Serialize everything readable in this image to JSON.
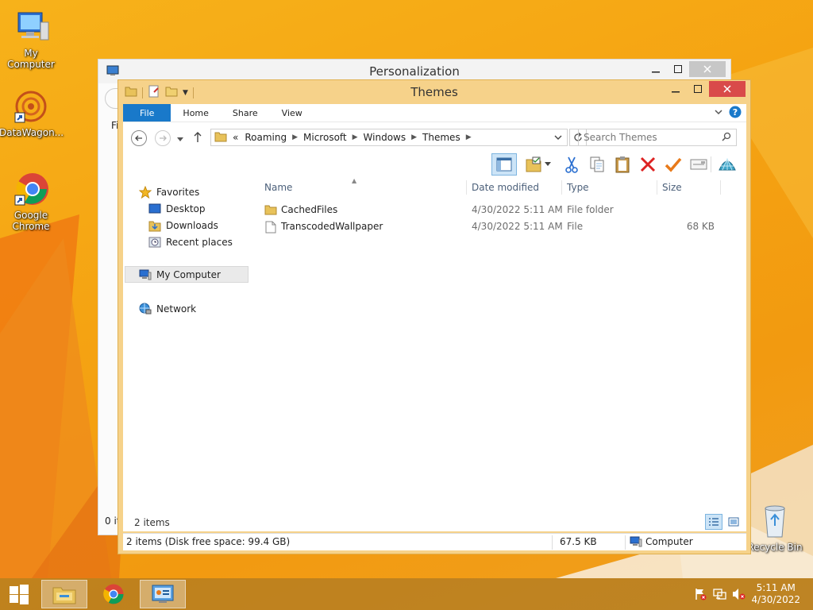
{
  "desktop": {
    "icons": [
      {
        "label": "My Computer"
      },
      {
        "label": "DataWagon..."
      },
      {
        "label": "Google Chrome"
      },
      {
        "label": "Recycle Bin"
      }
    ]
  },
  "back_window": {
    "title": "Personalization",
    "partial_labels": [
      "Fi",
      "0 it"
    ]
  },
  "main_window": {
    "title": "Themes",
    "ribbon_tabs": [
      {
        "label": "File"
      },
      {
        "label": "Home"
      },
      {
        "label": "Share"
      },
      {
        "label": "View"
      }
    ],
    "breadcrumb": [
      "«",
      "Roaming",
      "Microsoft",
      "Windows",
      "Themes"
    ],
    "search_placeholder": "Search Themes",
    "nav": {
      "favorites": "Favorites",
      "desktop": "Desktop",
      "downloads": "Downloads",
      "recent": "Recent places",
      "computer": "My Computer",
      "network": "Network"
    },
    "columns": {
      "name": "Name",
      "date": "Date modified",
      "type": "Type",
      "size": "Size"
    },
    "files": [
      {
        "name": "CachedFiles",
        "date": "4/30/2022 5:11 AM",
        "type": "File folder",
        "size": ""
      },
      {
        "name": "TranscodedWallpaper",
        "date": "4/30/2022 5:11 AM",
        "type": "File",
        "size": "68 KB"
      }
    ],
    "item_count": "2 items",
    "status": {
      "left": "2 items (Disk free space: 99.4 GB)",
      "size": "67.5 KB",
      "location": "Computer"
    }
  },
  "taskbar": {
    "time": "5:11 AM",
    "date": "4/30/2022"
  },
  "colors": {
    "accent": "#1979ca",
    "window_frame": "#f6d28a",
    "close_button": "#d94a4a"
  }
}
